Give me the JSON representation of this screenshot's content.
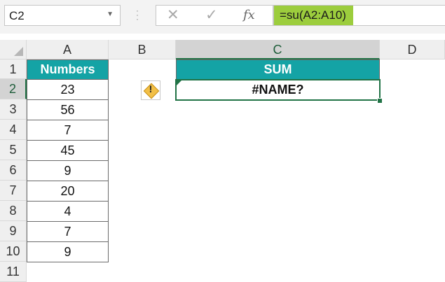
{
  "formula_bar": {
    "name_box": "C2",
    "cancel_icon": "✕",
    "enter_icon": "✓",
    "function_icon": "fx",
    "formula": "=su(A2:A10)",
    "highlight_color": "#9ccd3d"
  },
  "grid": {
    "columns": [
      "A",
      "B",
      "C",
      "D"
    ],
    "rows": [
      "1",
      "2",
      "3",
      "4",
      "5",
      "6",
      "7",
      "8",
      "9",
      "10",
      "11"
    ],
    "selected_column": "C",
    "selected_row": "2"
  },
  "table": {
    "header": "Numbers",
    "values": [
      "23",
      "56",
      "7",
      "45",
      "9",
      "20",
      "4",
      "7",
      "9"
    ],
    "header_color": "#14a3a5"
  },
  "result": {
    "header": "SUM",
    "value": "#NAME?",
    "error_icon": "!"
  }
}
